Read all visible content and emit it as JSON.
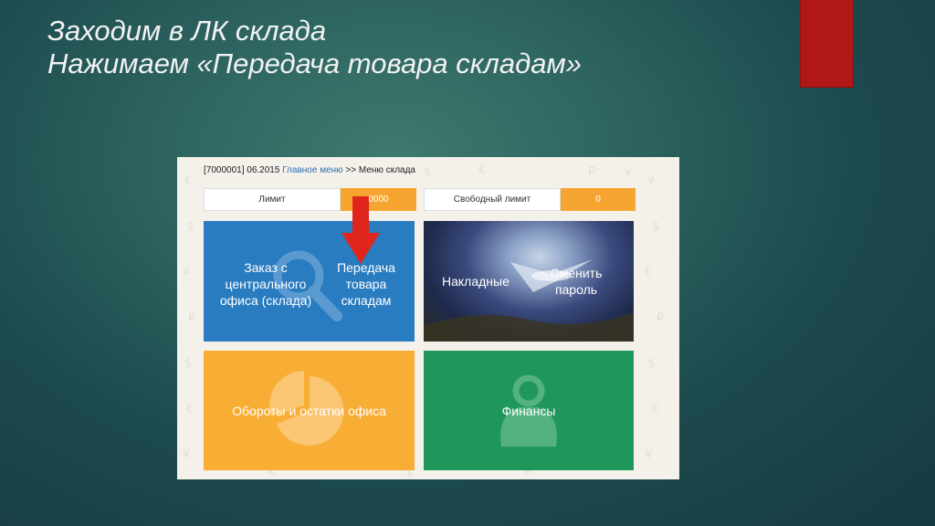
{
  "slide": {
    "title_line1": "Заходим в ЛК склада",
    "title_line2": "Нажимаем «Передача товара складам»"
  },
  "breadcrumb": {
    "prefix": "[7000001] 06.2015 ",
    "link": "Главное меню",
    "sep": " >> ",
    "current": "Меню склада"
  },
  "limits": {
    "limit_label": "Лимит",
    "limit_value": "0000",
    "free_label": "Свободный лимит",
    "free_value": "0"
  },
  "tiles": {
    "order_central": [
      "Заказ с",
      "центрального",
      "офиса (склада)"
    ],
    "transfer": [
      "Передача",
      "товара",
      "складам"
    ],
    "invoices": "Накладные",
    "change_password": [
      "Сменить",
      "пароль"
    ],
    "turnover": "Обороты и остатки офиса",
    "finance": "Финансы"
  },
  "colors": {
    "accent_red": "#b01818",
    "tile_blue": "#2a7cc0",
    "tile_orange": "#f8ad35",
    "tile_green": "#20975a",
    "limit_orange": "#f6a630"
  }
}
